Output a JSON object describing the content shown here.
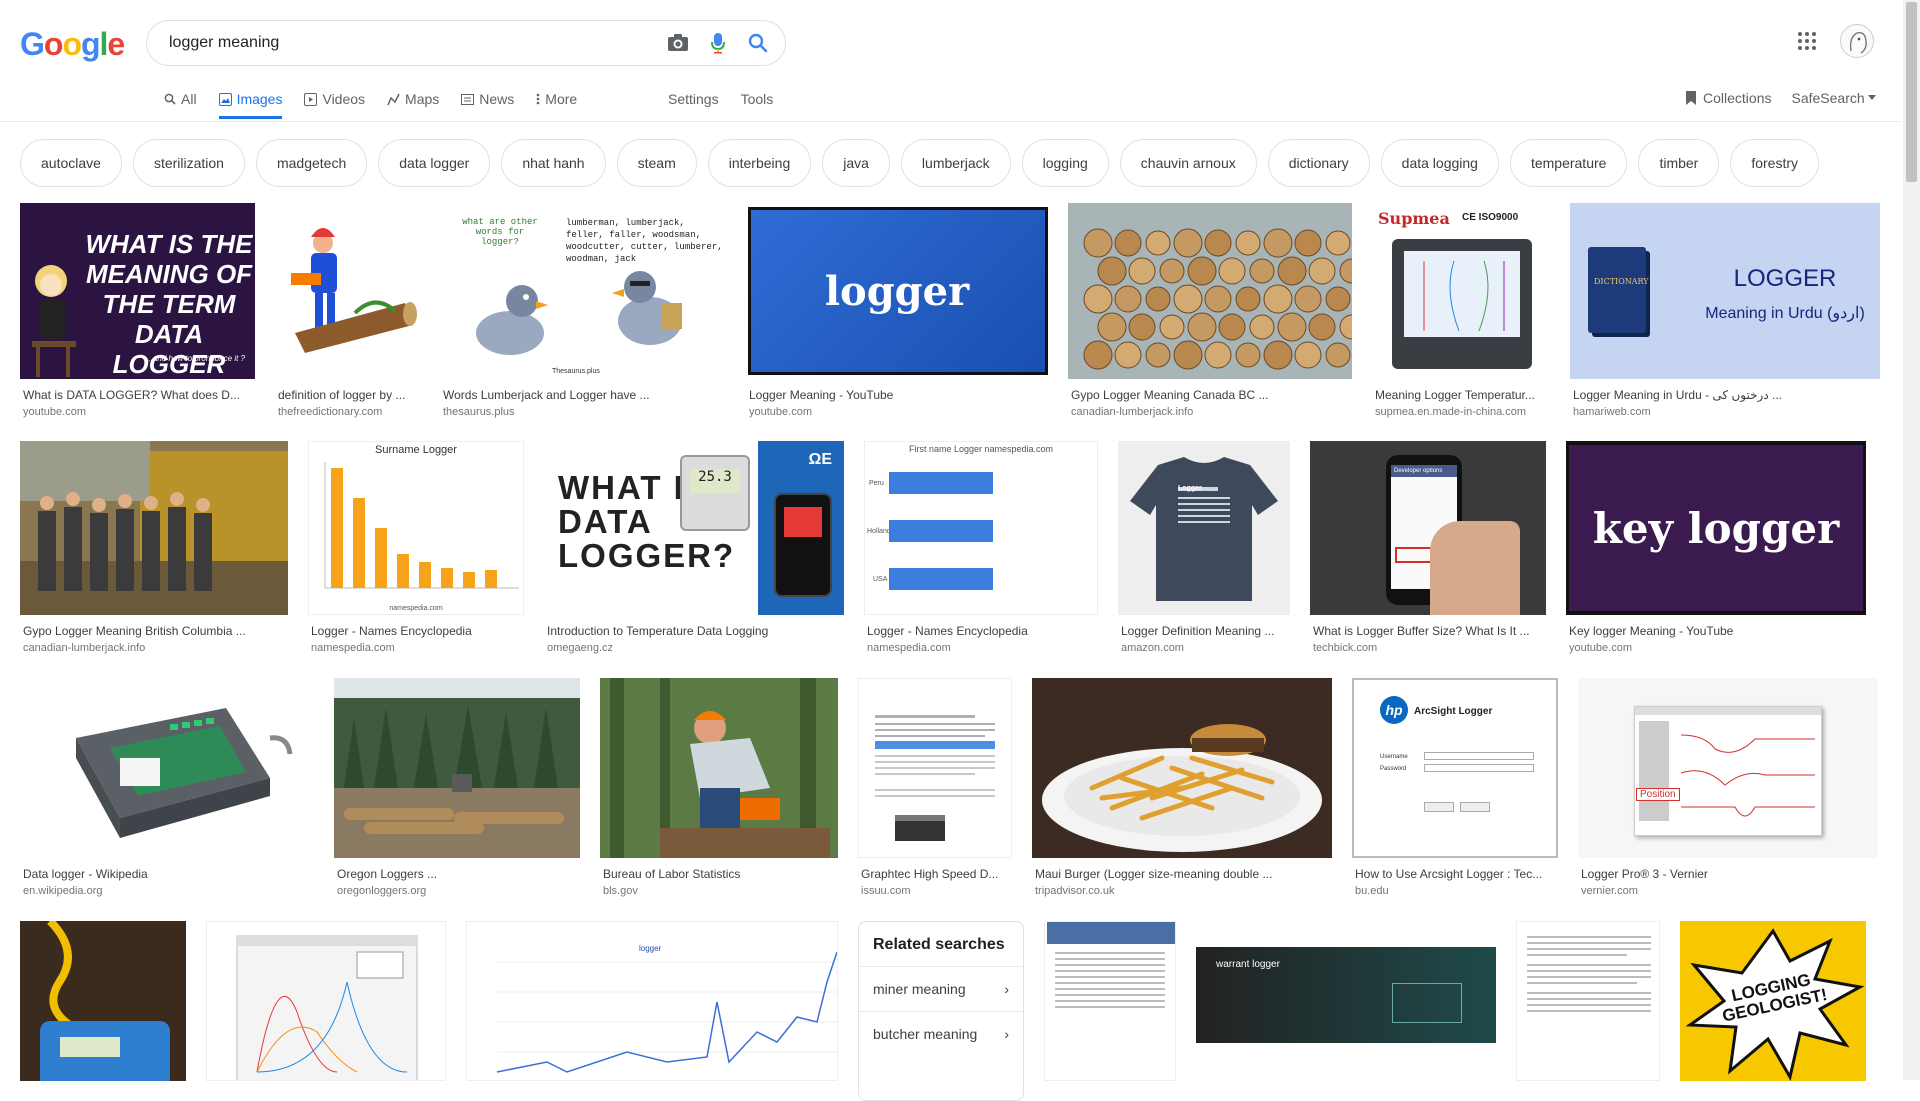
{
  "header": {
    "logo_letters": [
      {
        "ch": "G",
        "color": "#4285F4"
      },
      {
        "ch": "o",
        "color": "#EA4335"
      },
      {
        "ch": "o",
        "color": "#FBBC05"
      },
      {
        "ch": "g",
        "color": "#4285F4"
      },
      {
        "ch": "l",
        "color": "#34A853"
      },
      {
        "ch": "e",
        "color": "#EA4335"
      }
    ],
    "search_value": "logger meaning",
    "icons": [
      "camera-icon",
      "microphone-icon",
      "search-icon",
      "apps-grid-icon"
    ]
  },
  "tabs": [
    {
      "label": "All",
      "icon": "search-icon",
      "active": false
    },
    {
      "label": "Images",
      "icon": "image-icon",
      "active": true
    },
    {
      "label": "Videos",
      "icon": "video-icon",
      "active": false
    },
    {
      "label": "Maps",
      "icon": "map-icon",
      "active": false
    },
    {
      "label": "News",
      "icon": "news-icon",
      "active": false
    },
    {
      "label": "More",
      "icon": "more-dots-icon",
      "active": false
    }
  ],
  "tools_links": {
    "settings": "Settings",
    "tools": "Tools"
  },
  "right_links": {
    "collections": "Collections",
    "safesearch": "SafeSearch"
  },
  "chips": [
    "autoclave",
    "sterilization",
    "madgetech",
    "data logger",
    "nhat hanh",
    "steam",
    "interbeing",
    "java",
    "lumberjack",
    "logging",
    "chauvin arnoux",
    "dictionary",
    "data logging",
    "temperature",
    "timber",
    "forestry"
  ],
  "results_row1": [
    {
      "caption": "What is DATA LOGGER? What does D...",
      "source": "youtube.com",
      "thumb_text": "WHAT IS THE MEANING OF THE TERM data logger",
      "sub": "...and how to pronounce it ?"
    },
    {
      "caption": "definition of logger by ...",
      "source": "thefreedictionary.com"
    },
    {
      "caption": "Words Lumberjack and Logger have ...",
      "source": "thesaurus.plus",
      "thumb_q": "what are other words for logger?",
      "thumb_a": "lumberman, lumberjack, feller, faller, woodsman, woodcutter, cutter, lumberer, woodman, jack",
      "thumb_credit": "Thesaurus.plus"
    },
    {
      "caption": "Logger Meaning - YouTube",
      "source": "youtube.com",
      "thumb_text": "logger"
    },
    {
      "caption": "Gypo Logger Meaning Canada BC ...",
      "source": "canadian-lumberjack.info"
    },
    {
      "caption": "Meaning Logger Temperatur...",
      "source": "supmea.en.made-in-china.com",
      "thumb_brand": "Supmea",
      "thumb_cert": "CE ISO9000"
    },
    {
      "caption": "Logger Meaning in Urdu - درختوں کی ...",
      "source": "hamariweb.com",
      "thumb_title": "LOGGER",
      "thumb_sub": "Meaning in Urdu (اردو)",
      "thumb_book": "DICTIONARY"
    }
  ],
  "results_row2": [
    {
      "caption": "Gypo Logger Meaning British Columbia ...",
      "source": "canadian-lumberjack.info"
    },
    {
      "caption": "Logger - Names Encyclopedia",
      "source": "namespedia.com",
      "thumb_title": "Surname Logger",
      "thumb_footer": "namespedia.com"
    },
    {
      "caption": "Introduction to Temperature Data Logging",
      "source": "omegaeng.cz",
      "thumb_text": "WHAT IS A DATA LOGGER?",
      "thumb_brand": "ΩE",
      "thumb_reading": "25.3"
    },
    {
      "caption": "Logger - Names Encyclopedia",
      "source": "namespedia.com",
      "thumb_title": "First name Logger namespedia.com",
      "thumb_labels": [
        "Peru",
        "Holland",
        "USA"
      ]
    },
    {
      "caption": "Logger Definition Meaning ...",
      "source": "amazon.com",
      "thumb_shirt": "Logger"
    },
    {
      "caption": "What is Logger Buffer Size? What Is It ...",
      "source": "techbick.com",
      "thumb_screen": "Developer options"
    },
    {
      "caption": "Key logger Meaning - YouTube",
      "source": "youtube.com",
      "thumb_text": "key logger"
    }
  ],
  "results_row3": [
    {
      "caption": "Data logger - Wikipedia",
      "source": "en.wikipedia.org"
    },
    {
      "caption": "Oregon Loggers ...",
      "source": "oregonloggers.org"
    },
    {
      "caption": "Bureau of Labor Statistics",
      "source": "bls.gov"
    },
    {
      "caption": "Graphtec High Speed D...",
      "source": "issuu.com"
    },
    {
      "caption": "Maui Burger (Logger size-meaning double ...",
      "source": "tripadvisor.co.uk"
    },
    {
      "caption": "How to Use Arcsight Logger : Tec...",
      "source": "bu.edu",
      "thumb_title": "ArcSight Logger",
      "thumb_user": "Username",
      "thumb_pass": "Password"
    },
    {
      "caption": "Logger Pro® 3 - Vernier",
      "source": "vernier.com",
      "thumb_label": "Position"
    }
  ],
  "related": {
    "title": "Related searches",
    "items": [
      "miner meaning",
      "butcher meaning"
    ]
  },
  "row4_thumbs": {
    "warrant": "warrant logger",
    "geologist": "LOGGING GEOLOGIST!",
    "legend": "logger"
  }
}
